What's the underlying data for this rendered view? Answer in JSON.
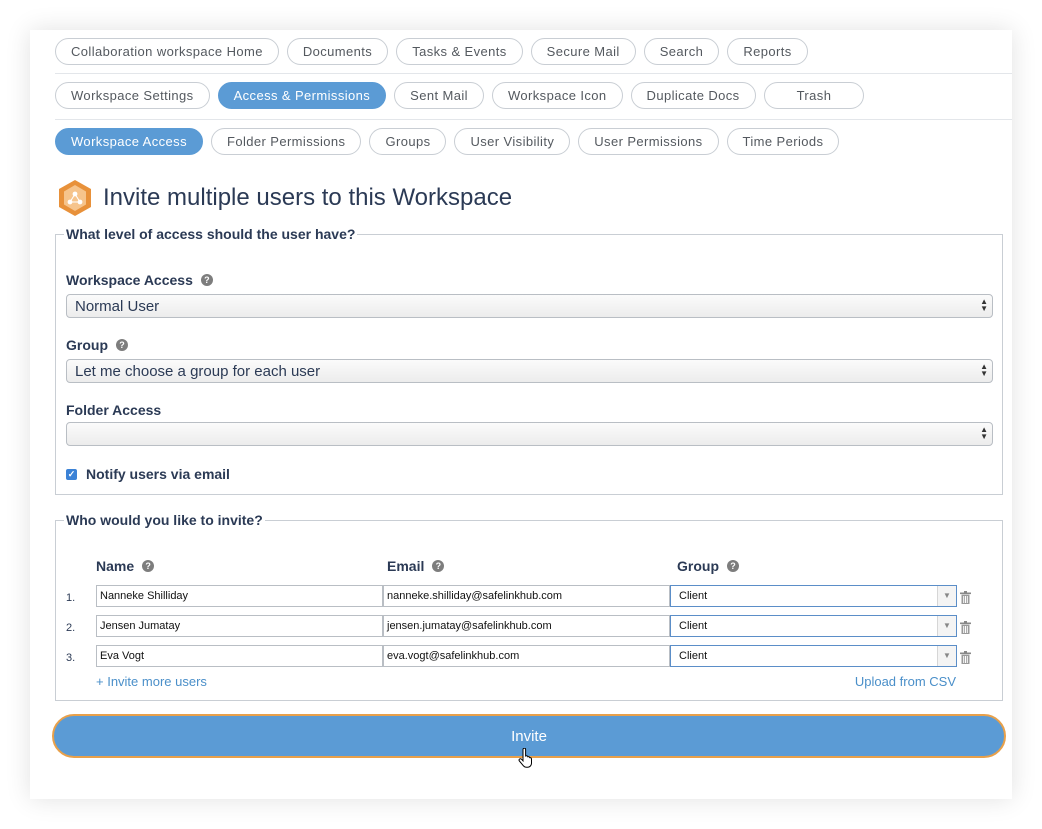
{
  "nav": {
    "row1": [
      "Collaboration workspace Home",
      "Documents",
      "Tasks & Events",
      "Secure Mail",
      "Search",
      "Reports"
    ],
    "row2": [
      "Workspace Settings",
      "Access & Permissions",
      "Sent Mail",
      "Workspace Icon",
      "Duplicate Docs",
      "Trash"
    ],
    "row3": [
      "Workspace Access",
      "Folder Permissions",
      "Groups",
      "User Visibility",
      "User Permissions",
      "Time Periods"
    ]
  },
  "page": {
    "title": "Invite multiple users to this Workspace"
  },
  "access_section": {
    "legend": "What level of access should the user have?",
    "workspace_access_label": "Workspace Access",
    "workspace_access_value": "Normal User",
    "group_label": "Group",
    "group_value": "Let me choose a group for each user",
    "folder_access_label": "Folder Access",
    "folder_access_value": "",
    "notify_label": "Notify users via email"
  },
  "invite_section": {
    "legend": "Who would you like to invite?",
    "col_name": "Name",
    "col_email": "Email",
    "col_group": "Group",
    "rows": [
      {
        "num": "1.",
        "name": "Nanneke Shilliday",
        "email": "nanneke.shilliday@safelinkhub.com",
        "group": "Client"
      },
      {
        "num": "2.",
        "name": "Jensen Jumatay",
        "email": "jensen.jumatay@safelinkhub.com",
        "group": "Client"
      },
      {
        "num": "3.",
        "name": "Eva Vogt",
        "email": "eva.vogt@safelinkhub.com",
        "group": "Client"
      }
    ],
    "invite_more": "+ Invite more users",
    "upload_csv": "Upload from CSV"
  },
  "invite_button": "Invite",
  "colors": {
    "accent": "#5b9bd5",
    "invite_border": "#e8a04a",
    "link": "#4a8fc9"
  }
}
